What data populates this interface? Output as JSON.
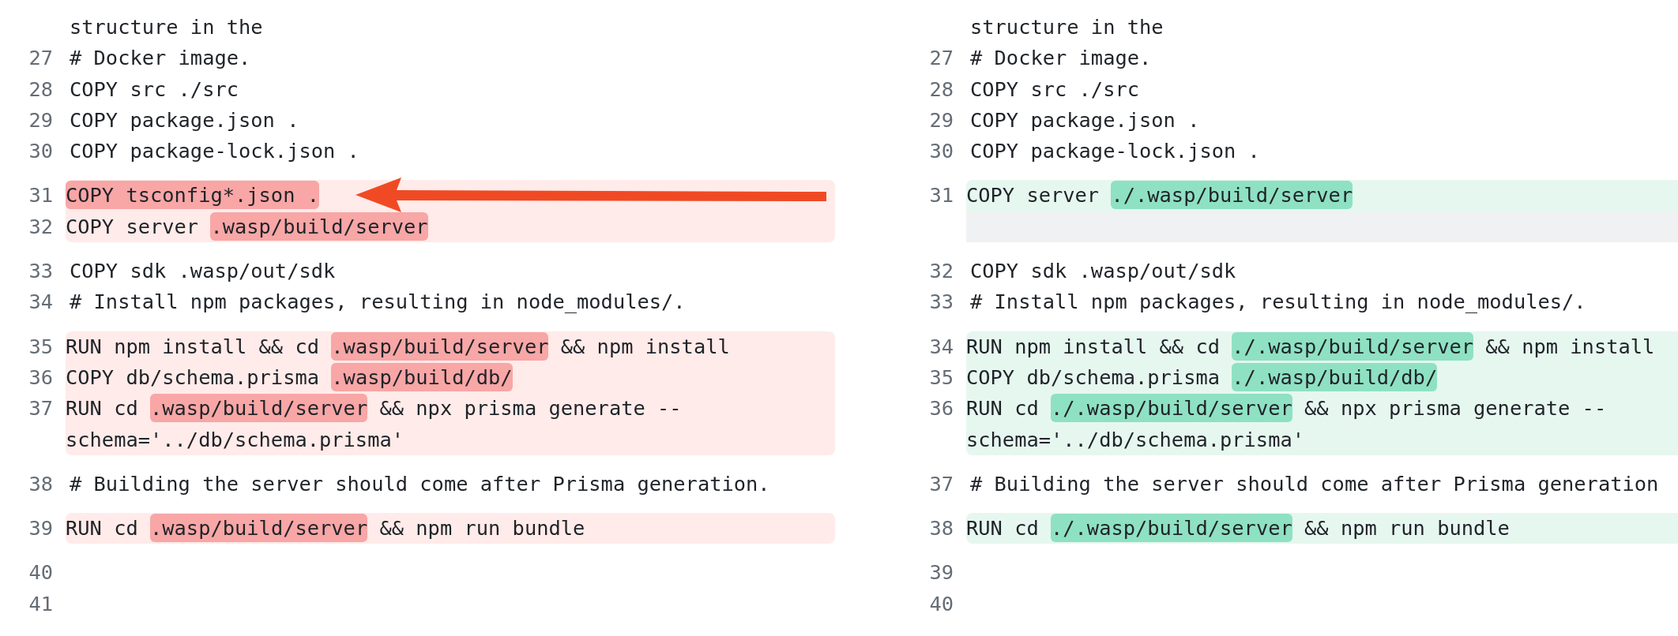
{
  "panes": [
    {
      "kind": "removed",
      "hunks": [
        {
          "kind": "context",
          "lines": [
            {
              "kind": "code",
              "rows": [
                [
                  {
                    "text": "structure in the",
                    "changed": false
                  }
                ]
              ]
            },
            {
              "kind": "code",
              "number": "27",
              "rows": [
                [
                  {
                    "text": "# Docker image.",
                    "changed": false
                  }
                ]
              ]
            },
            {
              "kind": "code",
              "number": "28",
              "rows": [
                [
                  {
                    "text": "COPY src ./src",
                    "changed": false
                  }
                ]
              ]
            },
            {
              "kind": "code",
              "number": "29",
              "rows": [
                [
                  {
                    "text": "COPY package.json .",
                    "changed": false
                  }
                ]
              ]
            },
            {
              "kind": "code",
              "number": "30",
              "rows": [
                [
                  {
                    "text": "COPY package-lock.json .",
                    "changed": false
                  }
                ]
              ]
            }
          ]
        },
        {
          "kind": "change",
          "lines": [
            {
              "kind": "code",
              "number": "31",
              "rows": [
                [
                  {
                    "text": "COPY tsconfig*.json .",
                    "changed": true
                  }
                ]
              ]
            },
            {
              "kind": "code",
              "number": "32",
              "rows": [
                [
                  {
                    "text": "COPY server ",
                    "changed": false
                  },
                  {
                    "text": ".wasp/build/server",
                    "changed": true
                  }
                ]
              ]
            }
          ]
        },
        {
          "kind": "context",
          "lines": [
            {
              "kind": "code",
              "number": "33",
              "rows": [
                [
                  {
                    "text": "COPY sdk .wasp/out/sdk",
                    "changed": false
                  }
                ]
              ]
            },
            {
              "kind": "code",
              "number": "34",
              "rows": [
                [
                  {
                    "text": "# Install npm packages, resulting in node_modules/.",
                    "changed": false
                  }
                ]
              ]
            }
          ]
        },
        {
          "kind": "change",
          "lines": [
            {
              "kind": "code",
              "number": "35",
              "rows": [
                [
                  {
                    "text": "RUN npm install && cd ",
                    "changed": false
                  },
                  {
                    "text": ".wasp/build/server",
                    "changed": true
                  },
                  {
                    "text": " && npm install",
                    "changed": false
                  }
                ]
              ]
            },
            {
              "kind": "code",
              "number": "36",
              "rows": [
                [
                  {
                    "text": "COPY db/schema.prisma ",
                    "changed": false
                  },
                  {
                    "text": ".wasp/build/db/",
                    "changed": true
                  }
                ]
              ]
            },
            {
              "kind": "code",
              "number": "37",
              "rows": [
                [
                  {
                    "text": "RUN cd ",
                    "changed": false
                  },
                  {
                    "text": ".wasp/build/server",
                    "changed": true
                  },
                  {
                    "text": " && npx prisma generate --",
                    "changed": false
                  }
                ],
                [
                  {
                    "text": "schema='../db/schema.prisma'",
                    "changed": false
                  }
                ]
              ]
            }
          ]
        },
        {
          "kind": "context",
          "lines": [
            {
              "kind": "code",
              "number": "38",
              "rows": [
                [
                  {
                    "text": "# Building the server should come after Prisma generation.",
                    "changed": false
                  }
                ]
              ]
            }
          ]
        },
        {
          "kind": "change",
          "lines": [
            {
              "kind": "code",
              "number": "39",
              "rows": [
                [
                  {
                    "text": "RUN cd ",
                    "changed": false
                  },
                  {
                    "text": ".wasp/build/server",
                    "changed": true
                  },
                  {
                    "text": " && npm run bundle",
                    "changed": false
                  }
                ]
              ]
            }
          ]
        },
        {
          "kind": "context",
          "lines": [
            {
              "kind": "code",
              "number": "40",
              "rows": [
                []
              ]
            },
            {
              "kind": "code",
              "number": "41",
              "rows": [
                []
              ]
            }
          ]
        }
      ]
    },
    {
      "kind": "added",
      "hunks": [
        {
          "kind": "context",
          "lines": [
            {
              "kind": "code",
              "rows": [
                [
                  {
                    "text": "structure in the",
                    "changed": false
                  }
                ]
              ]
            },
            {
              "kind": "code",
              "number": "27",
              "rows": [
                [
                  {
                    "text": "# Docker image.",
                    "changed": false
                  }
                ]
              ]
            },
            {
              "kind": "code",
              "number": "28",
              "rows": [
                [
                  {
                    "text": "COPY src ./src",
                    "changed": false
                  }
                ]
              ]
            },
            {
              "kind": "code",
              "number": "29",
              "rows": [
                [
                  {
                    "text": "COPY package.json .",
                    "changed": false
                  }
                ]
              ]
            },
            {
              "kind": "code",
              "number": "30",
              "rows": [
                [
                  {
                    "text": "COPY package-lock.json .",
                    "changed": false
                  }
                ]
              ]
            }
          ]
        },
        {
          "kind": "change",
          "lines": [
            {
              "kind": "code",
              "number": "31",
              "rows": [
                [
                  {
                    "text": "COPY server ",
                    "changed": false
                  },
                  {
                    "text": "./.wasp/build/server",
                    "changed": true
                  }
                ]
              ]
            },
            {
              "kind": "filler"
            }
          ]
        },
        {
          "kind": "context",
          "lines": [
            {
              "kind": "code",
              "number": "32",
              "rows": [
                [
                  {
                    "text": "COPY sdk .wasp/out/sdk",
                    "changed": false
                  }
                ]
              ]
            },
            {
              "kind": "code",
              "number": "33",
              "rows": [
                [
                  {
                    "text": "# Install npm packages, resulting in node_modules/.",
                    "changed": false
                  }
                ]
              ]
            }
          ]
        },
        {
          "kind": "change",
          "lines": [
            {
              "kind": "code",
              "number": "34",
              "rows": [
                [
                  {
                    "text": "RUN npm install && cd ",
                    "changed": false
                  },
                  {
                    "text": "./.wasp/build/server",
                    "changed": true
                  },
                  {
                    "text": " && npm install",
                    "changed": false
                  }
                ]
              ]
            },
            {
              "kind": "code",
              "number": "35",
              "rows": [
                [
                  {
                    "text": "COPY db/schema.prisma ",
                    "changed": false
                  },
                  {
                    "text": "./.wasp/build/db/",
                    "changed": true
                  }
                ]
              ]
            },
            {
              "kind": "code",
              "number": "36",
              "rows": [
                [
                  {
                    "text": "RUN cd ",
                    "changed": false
                  },
                  {
                    "text": "./.wasp/build/server",
                    "changed": true
                  },
                  {
                    "text": " && npx prisma generate --",
                    "changed": false
                  }
                ],
                [
                  {
                    "text": "schema='../db/schema.prisma'",
                    "changed": false
                  }
                ]
              ]
            }
          ]
        },
        {
          "kind": "context",
          "lines": [
            {
              "kind": "code",
              "number": "37",
              "rows": [
                [
                  {
                    "text": "# Building the server should come after Prisma generation",
                    "changed": false
                  }
                ]
              ]
            }
          ]
        },
        {
          "kind": "change",
          "lines": [
            {
              "kind": "code",
              "number": "38",
              "rows": [
                [
                  {
                    "text": "RUN cd ",
                    "changed": false
                  },
                  {
                    "text": "./.wasp/build/server",
                    "changed": true
                  },
                  {
                    "text": " && npm run bundle",
                    "changed": false
                  }
                ]
              ]
            }
          ]
        },
        {
          "kind": "context",
          "lines": [
            {
              "kind": "code",
              "number": "39",
              "rows": [
                []
              ]
            },
            {
              "kind": "code",
              "number": "40",
              "rows": [
                []
              ]
            }
          ]
        }
      ]
    }
  ]
}
